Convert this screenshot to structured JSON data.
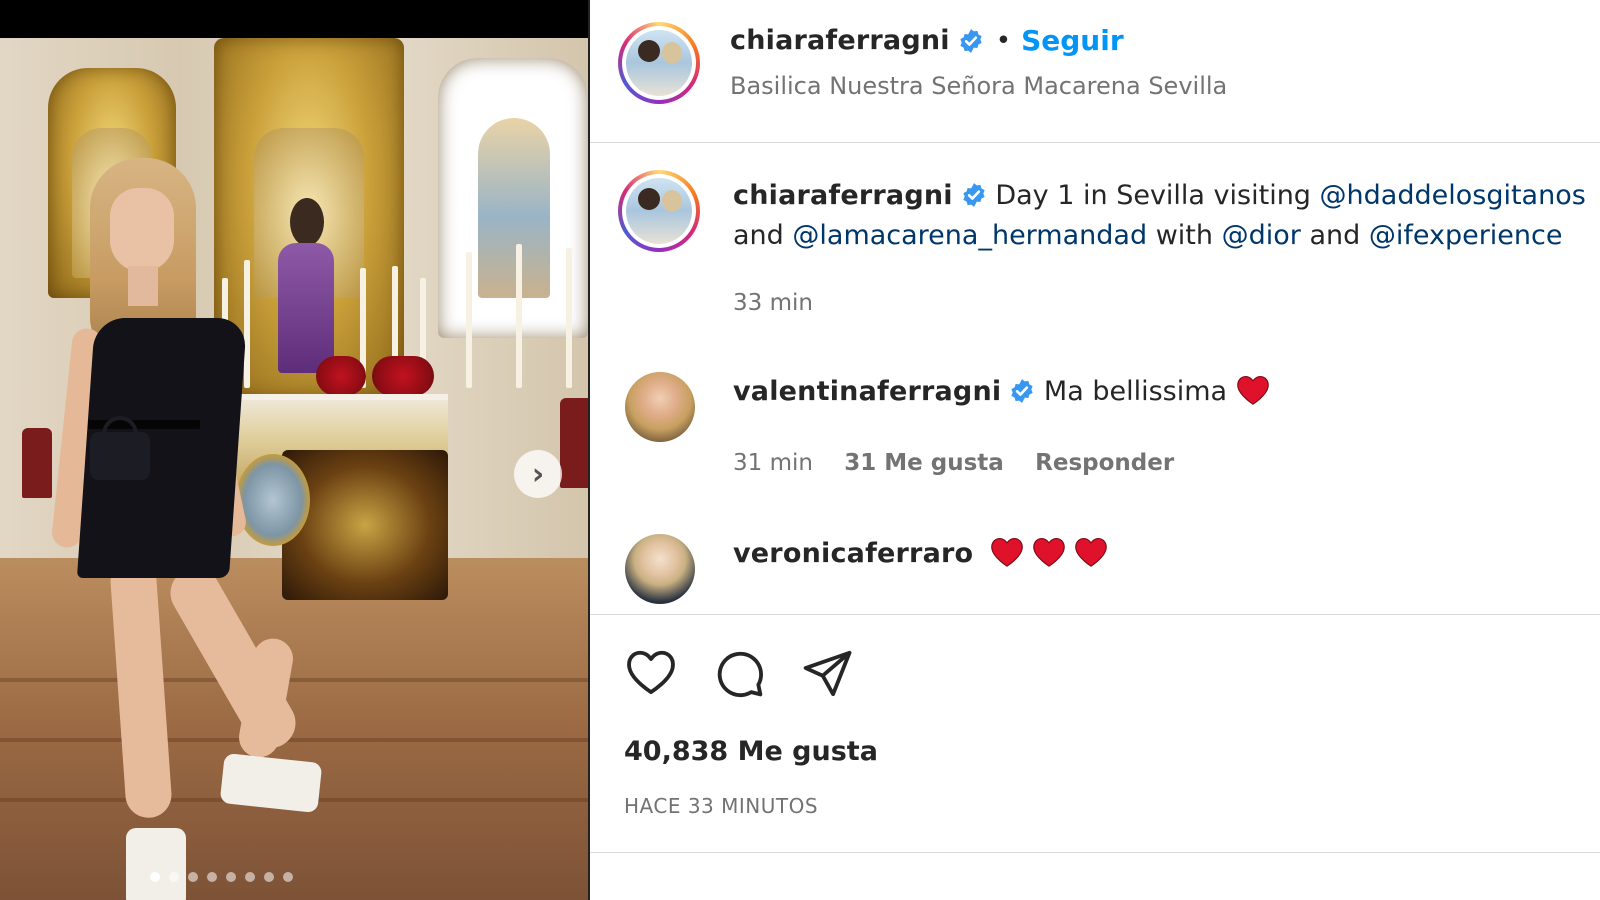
{
  "post": {
    "author": "chiaraferragni",
    "follow_label": "Seguir",
    "separator": "•",
    "location": "Basilica Nuestra Señora Macarena Sevilla",
    "caption": {
      "text_1": "Day 1 in Sevilla visiting",
      "mention_1": "@hdaddelosgitanos",
      "text_2": "and",
      "mention_2": "@lamacarena_hermandad",
      "text_3": "with",
      "mention_3": "@dior",
      "text_4": "and",
      "mention_4": "@ifexperience",
      "time": "33 min"
    },
    "likes": "40,838 Me gusta",
    "time_ago": "HACE 33 MINUTOS"
  },
  "comments": [
    {
      "username": "valentinaferragni",
      "text": "Ma bellissima",
      "time": "31 min",
      "likes": "31 Me gusta",
      "reply_label": "Responder"
    },
    {
      "username": "veronicaferraro",
      "text": ""
    }
  ],
  "carousel": {
    "slide_count": 8,
    "active_index": 0
  },
  "icons": {
    "verified": "verified-badge-icon",
    "like": "heart-outline-icon",
    "comment": "comment-bubble-icon",
    "share": "paper-plane-icon",
    "next": "chevron-right-icon",
    "emoji": "red-heart-icon"
  },
  "colors": {
    "follow_blue": "#0095f6",
    "verified_blue": "#3897f0",
    "mention_blue": "#00376b",
    "muted_gray": "#737373",
    "heart_red": "#e0112b"
  }
}
